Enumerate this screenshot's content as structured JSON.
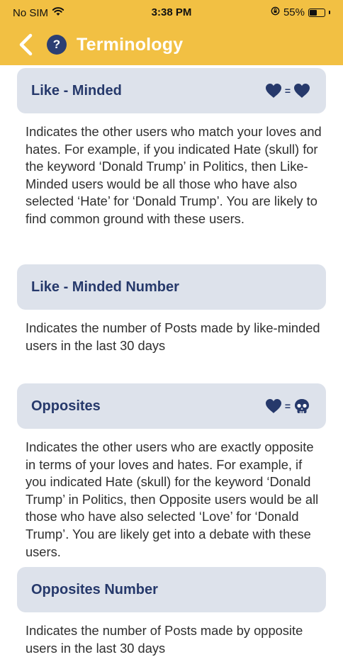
{
  "status_bar": {
    "carrier": "No SIM",
    "time": "3:38 PM",
    "battery_percent": "55%",
    "battery_level": 0.55
  },
  "navbar": {
    "back_icon": "chevron-left-icon",
    "help_label": "?",
    "title": "Terminology"
  },
  "colors": {
    "header": "#f2c043",
    "card": "#dde2eb",
    "accent": "#26396b"
  },
  "terms": [
    {
      "title": "Like - Minded",
      "relation": {
        "left": "heart-icon",
        "operator": "=",
        "right": "heart-icon"
      },
      "description": "Indicates the other users who match your loves and hates. For example, if you indicated Hate (skull) for the keyword ‘Donald Trump’ in Politics, then Like-Minded users would be all those who have also selected ‘Hate’ for ‘Donald Trump’. You are likely to find common ground with these users."
    },
    {
      "title": "Like - Minded Number",
      "description": "Indicates the number of Posts made by like-minded users in the last 30 days"
    },
    {
      "title": "Opposites",
      "relation": {
        "left": "heart-icon",
        "operator": "=",
        "right": "skull-icon"
      },
      "description": "Indicates the other users who are exactly opposite in terms of your loves and hates. For example, if you indicated Hate (skull) for the keyword ‘Donald Trump’ in Politics, then Opposite users would be all those who have also selected ‘Love’ for ‘Donald Trump’. You are likely get into a debate with these users."
    },
    {
      "title": "Opposites Number",
      "description": "Indicates the number of Posts made by opposite users in the last 30 days"
    }
  ]
}
